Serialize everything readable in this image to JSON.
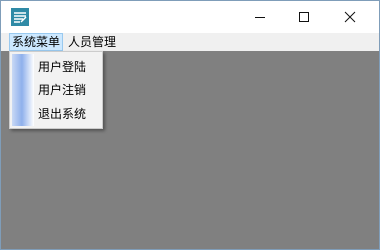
{
  "window": {
    "icons": {
      "app": "app-icon",
      "minimize": "minimize-icon",
      "maximize": "maximize-icon",
      "close": "close-icon"
    }
  },
  "menubar": {
    "items": [
      {
        "label": "系统菜单"
      },
      {
        "label": "人员管理"
      }
    ]
  },
  "dropdown": {
    "items": [
      {
        "label": "用户登陆"
      },
      {
        "label": "用户注销"
      },
      {
        "label": "退出系统"
      }
    ]
  },
  "colors": {
    "workspace": "#808080",
    "menubar": "#f0f0f0",
    "menu_highlight": "#cce8ff"
  }
}
